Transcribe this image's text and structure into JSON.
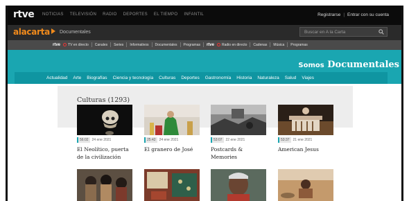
{
  "topbar": {
    "logo": "rtve",
    "nav": [
      "NOTICIAS",
      "TELEVISIÓN",
      "RADIO",
      "DEPORTES",
      "EL TIEMPO",
      "INFANTIL"
    ],
    "register": "Registrarse",
    "separator": "|",
    "login": "Entrar con su cuenta"
  },
  "alacarta": {
    "logo": "alacarta",
    "section": "Documentales",
    "search_placeholder": "Buscar en A la Carta"
  },
  "channels": {
    "items": [
      "rtve",
      "TV en directo",
      "Canales",
      "Series",
      "Informativos",
      "Documentales",
      "Programas",
      "rtve",
      "Radio en directo",
      "Cadenas",
      "Música",
      "Programas"
    ]
  },
  "brand": {
    "somos": "Somos",
    "name": "Documentales"
  },
  "categories": [
    "Actualidad",
    "Arte",
    "Biografías",
    "Ciencia y tecnología",
    "Culturas",
    "Deportes",
    "Gastronomía",
    "Historia",
    "Naturaleza",
    "Salud",
    "Viajes"
  ],
  "content": {
    "title": "Culturas  (1293)",
    "cards": [
      {
        "duration": "56:02",
        "date": "24 ene 2021",
        "title": "El Neolítico, puerta de la civilización"
      },
      {
        "duration": "25:42",
        "date": "24 ene 2021",
        "title": "El granero de José"
      },
      {
        "duration": "53:07",
        "date": "22 ene 2021",
        "title": "Postcards & Memories"
      },
      {
        "duration": "53:37",
        "date": "21 ene 2021",
        "title": "American Jesus"
      }
    ]
  },
  "colors": {
    "teal": "#1aa6b1",
    "orange": "#f08a1c",
    "dark": "#0b0b0b"
  }
}
